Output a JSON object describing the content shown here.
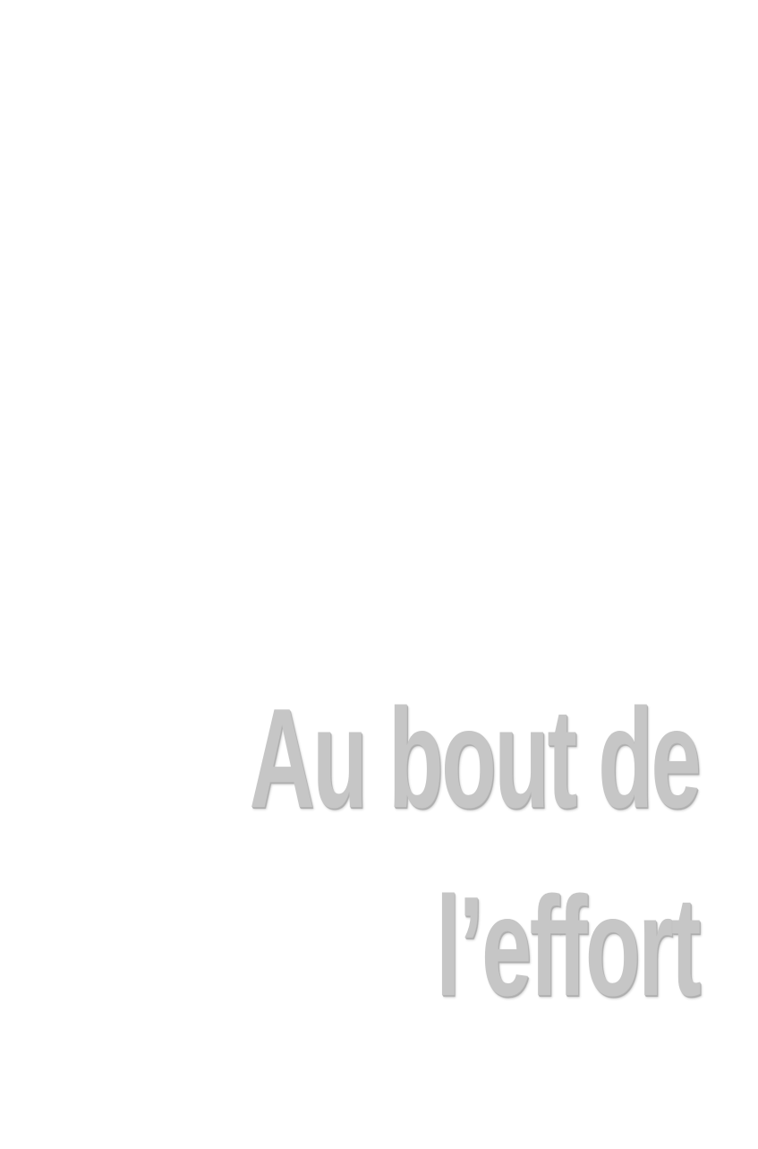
{
  "title": {
    "line1": "Au bout de",
    "line2": "l’effort"
  },
  "colors": {
    "background": "#ffffff",
    "title_text": "#c6c6c6"
  }
}
